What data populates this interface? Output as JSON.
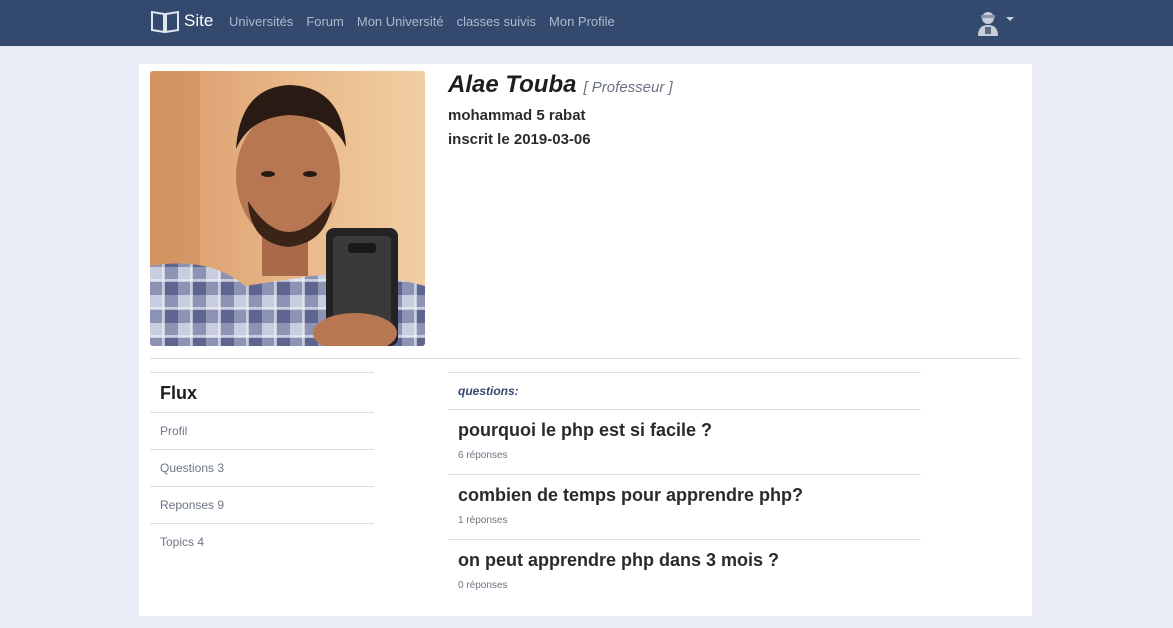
{
  "navbar": {
    "brand": "Site",
    "links": [
      "Universités",
      "Forum",
      "Mon Université",
      "classes suivis",
      "Mon Profile"
    ],
    "colors": {
      "background": "#34496e",
      "link": "#aeb9cc"
    }
  },
  "profile": {
    "name": "Alae Touba",
    "role": "[ Professeur ]",
    "school": "mohammad 5 rabat",
    "joined": "inscrit le 2019-03-06"
  },
  "sidebar": {
    "title": "Flux",
    "items": [
      "Profil",
      "Questions 3",
      "Reponses 9",
      "Topics 4"
    ]
  },
  "questions": {
    "label": "questions:",
    "items": [
      {
        "title": "pourquoi le php est si facile ?",
        "count": "6 réponses"
      },
      {
        "title": "combien de temps pour apprendre php?",
        "count": "1 réponses"
      },
      {
        "title": "on peut apprendre php dans 3 mois ?",
        "count": "0 réponses"
      }
    ]
  },
  "icons": {
    "brand": "open-book-icon",
    "user": "user-avatar-icon",
    "menu": "caret-down-icon"
  }
}
